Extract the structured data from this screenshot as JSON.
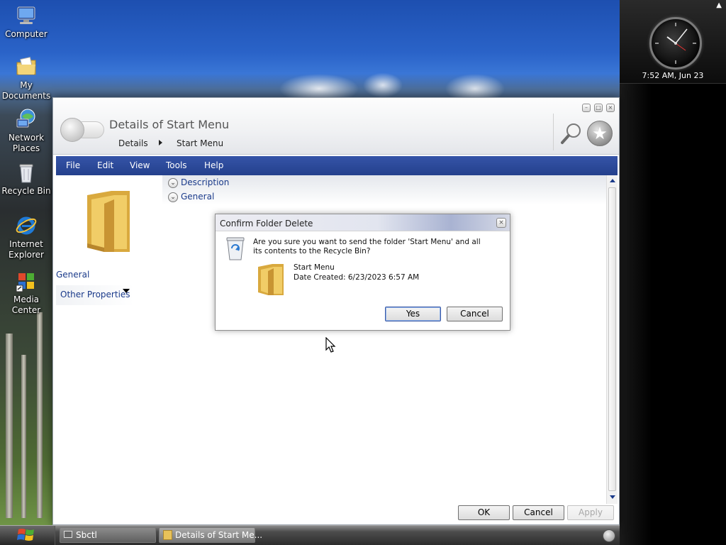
{
  "desktop": {
    "icons": [
      {
        "name": "computer-icon",
        "label": "Computer"
      },
      {
        "name": "my-documents-icon",
        "label": "My Documents"
      },
      {
        "name": "network-places-icon",
        "label": "Network Places"
      },
      {
        "name": "recycle-bin-icon",
        "label": "Recycle Bin"
      },
      {
        "name": "internet-explorer-icon",
        "label": "Internet Explorer"
      },
      {
        "name": "media-center-icon",
        "label": "Media Center"
      }
    ]
  },
  "sidebar": {
    "clock_text": "7:52 AM, Jun 23"
  },
  "window": {
    "title": "Details of Start Menu",
    "breadcrumb": [
      "Details",
      "Start Menu"
    ],
    "menu": [
      "File",
      "Edit",
      "View",
      "Tools",
      "Help"
    ],
    "side_panel": {
      "general_label": "General",
      "other_properties_label": "Other Properties"
    },
    "sections": [
      "Description",
      "General"
    ],
    "footer": {
      "ok_label": "OK",
      "cancel_label": "Cancel",
      "apply_label": "Apply"
    }
  },
  "dialog": {
    "title": "Confirm Folder Delete",
    "message": "Are you sure you want to send the folder 'Start Menu' and all its contents to the Recycle Bin?",
    "file_name": "Start Menu",
    "date_created": "Date Created: 6/23/2023 6:57 AM",
    "yes_label": "Yes",
    "cancel_label": "Cancel"
  },
  "taskbar": {
    "items": [
      "Sbctl",
      "Details of Start Me..."
    ]
  },
  "colors": {
    "menu_bar": "#24408c",
    "link_text": "#1a3a8a",
    "folder": "#e8c25a"
  }
}
